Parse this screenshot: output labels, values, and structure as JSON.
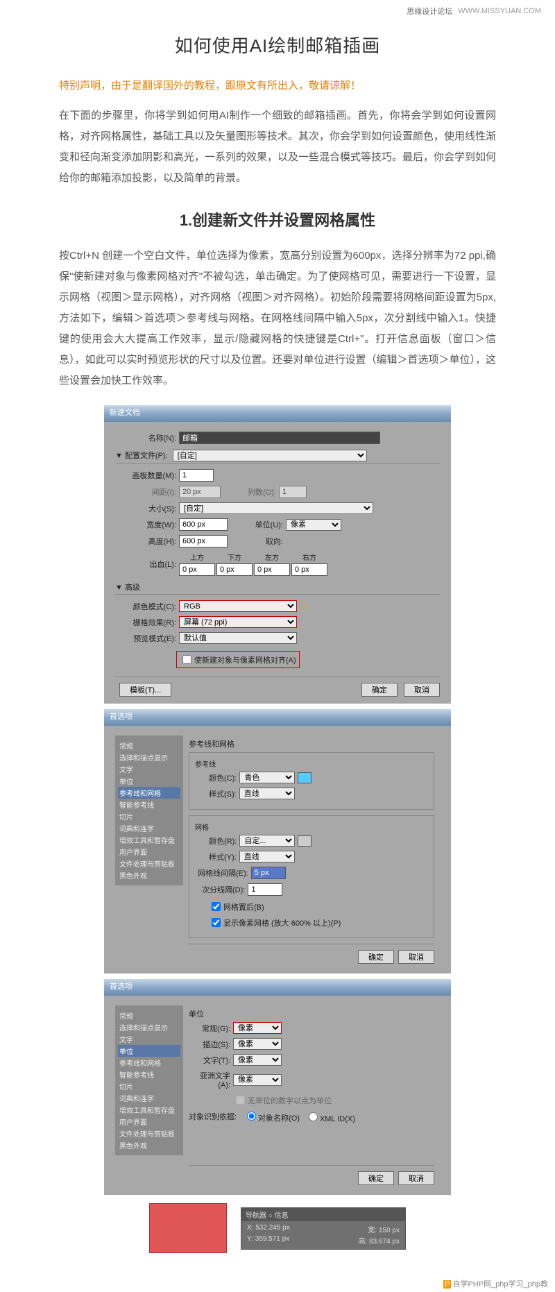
{
  "meta": {
    "forum": "思缘设计论坛",
    "url": "WWW.MISSYUAN.COM"
  },
  "title": "如何使用AI绘制邮箱插画",
  "notice": "特别声明，由于是翻译国外的教程，跟原文有所出入，敬请谅解！",
  "intro": "在下面的步骤里，你将学到如何用AI制作一个细致的邮箱插画。首先，你将会学到如何设置网格，对齐网格属性，基础工具以及矢量图形等技术。其次，你会学到如何设置颜色，使用线性渐变和径向渐变添加阴影和高光，一系列的效果，以及一些混合模式等技巧。最后，你会学到如何给你的邮箱添加投影，以及简单的背景。",
  "section1": {
    "title": "1.创建新文件并设置网格属性",
    "body": "按Ctrl+N 创建一个空白文件，单位选择为像素，宽高分别设置为600px，选择分辨率为72 ppi,确保\"使新建对象与像素网格对齐\"不被勾选，单击确定。为了使网格可见，需要进行一下设置，显示网格（视图＞显示网格），对齐网格（视图＞对齐网格）。初始阶段需要将网格间距设置为5px,方法如下，编辑＞首选项＞参考线与网格。在网格线间隔中输入5px，次分割线中输入1。快捷键的使用会大大提高工作效率，显示/隐藏网格的快捷键是Ctrl+\"。打开信息面板（窗口＞信息），如此可以实时预览形状的尺寸以及位置。还要对单位进行设置（编辑＞首选项＞单位），这些设置会加快工作效率。"
  },
  "dlg1": {
    "title": "新建文档",
    "name_l": "名称(N):",
    "name_v": "邮箱",
    "profile_l": "配置文件(P):",
    "profile_v": "[自定]",
    "artboards_l": "画板数量(M):",
    "artboards_v": "1",
    "spacing_l": "间距(I):",
    "spacing_v": "20 px",
    "cols_l": "列数(O):",
    "cols_v": "1",
    "size_l": "大小(S):",
    "size_v": "[自定]",
    "width_l": "宽度(W):",
    "width_v": "600 px",
    "unit_l": "单位(U):",
    "unit_v": "像素",
    "height_l": "高度(H):",
    "height_v": "600 px",
    "orient_l": "取向:",
    "bleed_l": "出血(L):",
    "bleed": {
      "top": "上方",
      "bottom": "下方",
      "left": "左方",
      "right": "右方",
      "v": "0 px"
    },
    "adv": "高级",
    "cmode_l": "颜色模式(C):",
    "cmode_v": "RGB",
    "raster_l": "栅格效果(R):",
    "raster_v": "屏幕 (72 ppi)",
    "preview_l": "预览模式(E):",
    "preview_v": "默认值",
    "align_chk": "使新建对象与像素网格对齐(A)",
    "template": "模板(T)...",
    "ok": "确定",
    "cancel": "取消"
  },
  "prefs": {
    "title": "首选项",
    "sidebar": [
      "常规",
      "选择和描点显示",
      "文字",
      "单位",
      "参考线和网格",
      "智能参考线",
      "切片",
      "词典和连字",
      "增效工具和暂存盘",
      "用户界面",
      "文件处理与剪贴板",
      "黑色外观"
    ],
    "guides": {
      "heading": "参考线和网格",
      "guides_group": "参考线",
      "grid_group": "网格",
      "color_l": "颜色(C):",
      "color_v": "青色",
      "style_l": "样式(S):",
      "style_v": "直线",
      "gcolor_l": "颜色(R):",
      "gcolor_v": "自定...",
      "gstyle_l": "样式(Y):",
      "gstyle_v": "直线",
      "gap_l": "网格线间隔(E):",
      "gap_v": "5 px",
      "sub_l": "次分线隔(D):",
      "sub_v": "1",
      "back_chk": "网格置后(B)",
      "show_chk": "显示像素网格 (放大 600% 以上)(P)"
    },
    "units": {
      "heading": "单位",
      "general_l": "常规(G):",
      "general_v": "像素",
      "stroke_l": "描边(S):",
      "stroke_v": "像素",
      "type_l": "文字(T):",
      "type_v": "像素",
      "asian_l": "亚洲文字(A):",
      "asian_v": "像素",
      "note_chk": "无单位的数字以点为单位",
      "ident_l": "对象识别依据:",
      "ident_a": "对象名称(O)",
      "ident_b": "XML ID(X)"
    },
    "ok": "确定",
    "cancel": "取消"
  },
  "info": {
    "tabs": "导航器 ○ 信息",
    "x": "X: 532.245 px",
    "y": "Y: 359.571 px",
    "w": "宽:   150 px",
    "h": "高: 83.674 px"
  },
  "footer": {
    "site": "自学PHP网_php学习_php教"
  }
}
